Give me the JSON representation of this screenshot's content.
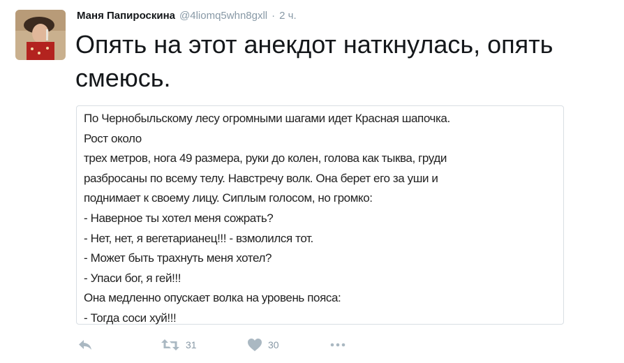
{
  "tweet": {
    "author_name": "Маня Папироскина",
    "author_handle": "@4liomq5whn8gxll",
    "separator": "·",
    "time": "2 ч.",
    "text": "Опять на этот анекдот наткнулась, опять смеюсь."
  },
  "card": {
    "lines": [
      "По Чернобыльскому лесу огромными шагами идет Красная шапочка.",
      "Рост около",
      "трех метров, нога 49 размера, руки до колен, голова как тыква, груди",
      "разбросаны по всему телу. Навстречу волк. Она берет его за уши и",
      "поднимает к своему лицу. Сиплым голосом, но громко:",
      "- Наверное ты хотел меня сожрать?",
      "- Нет, нет, я вегетарианец!!! - взмолился тот.",
      "- Может быть трахнуть меня хотел?",
      "- Упаси бог, я гей!!!",
      "Она медленно опускает волка на уровень пояса:",
      "- Тогда соси хуй!!!"
    ]
  },
  "actions": {
    "reply_icon": "reply-icon",
    "retweet_icon": "retweet-icon",
    "retweet_count": "31",
    "like_icon": "heart-icon",
    "like_count": "30",
    "more_icon": "more-icon"
  },
  "colors": {
    "text": "#14171a",
    "muted": "#8899a6",
    "icon": "#aab8c2",
    "card_border": "#d8dee3"
  }
}
